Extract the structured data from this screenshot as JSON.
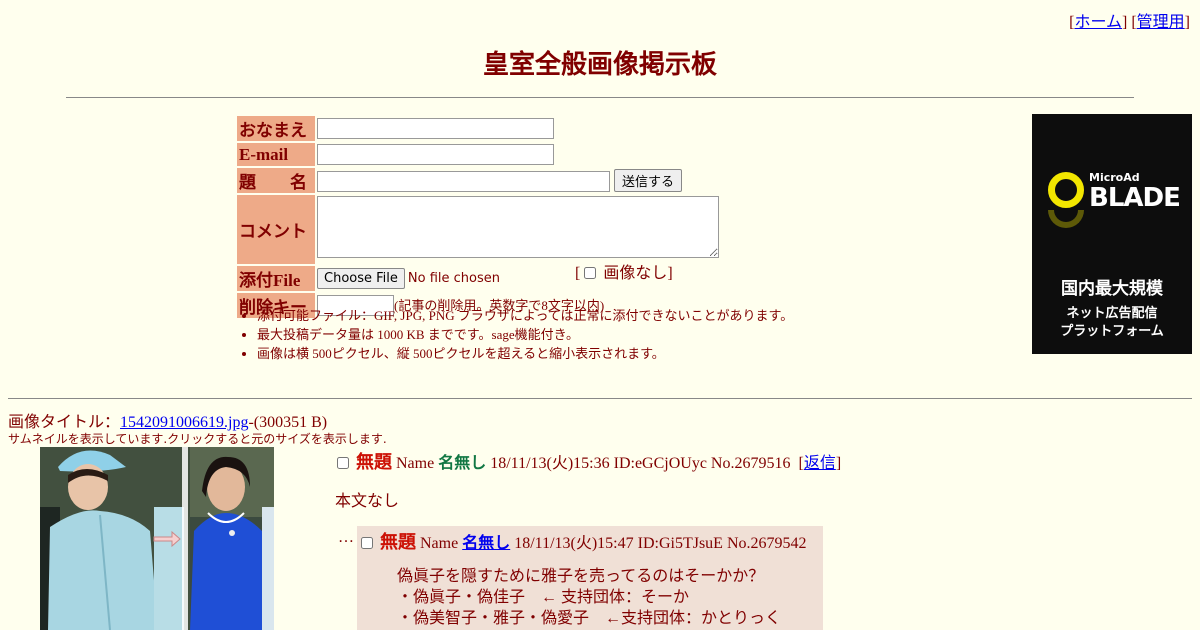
{
  "nav": {
    "home": "ホーム",
    "admin": "管理用",
    "lb": "[",
    "rb": "]"
  },
  "title": "皇室全般画像掲示板",
  "form": {
    "name_label": "おなまえ",
    "email_label": "E-mail",
    "subject_label": "題　　名",
    "submit_label": "送信する",
    "comment_label": "コメント",
    "file_label": "添付File",
    "file_button": "Choose File",
    "file_status": "No file chosen",
    "noimg_lb": "[",
    "noimg_label": "画像なし",
    "noimg_rb": "]",
    "delkey_label": "削除キー",
    "delkey_note": "(記事の削除用。英数字で8文字以内)"
  },
  "notes": [
    "添付可能ファイル：GIF, JPG, PNG ブラウザによっては正常に添付できないことがあります。",
    "最大投稿データ量は 1000 KB までです。sage機能付き。",
    "画像は横 500ピクセル、縦 500ピクセルを超えると縮小表示されます。"
  ],
  "ad": {
    "brand_small": "MicroAd",
    "brand_big": "BLADE",
    "line1": "国内最大規模",
    "line2": "ネット広告配信",
    "line3": "プラットフォーム"
  },
  "thread": {
    "image_title_label": "画像タイトル：",
    "image_file": "1542091006619.jpg",
    "image_size": "-(300351 B)",
    "thumb_note": "サムネイルを表示しています.クリックすると元のサイズを表示します.",
    "op": {
      "subject": "無題",
      "name_label": "Name",
      "name": "名無し",
      "date": "18/11/13(火)15:36 ID:eGCjOUyc No.2679516",
      "reply_lb": "[",
      "reply_link": "返信",
      "reply_rb": "]",
      "body": "本文なし"
    },
    "reply": {
      "marker": "…",
      "subject": "無題",
      "name_label": "Name",
      "name": "名無し",
      "date": "18/11/13(火)15:47 ID:Gi5TJsuE No.2679542",
      "lines": [
        "偽眞子を隠すために雅子を売ってるのはそーかか？",
        "・偽眞子・偽佳子　← 支持団体：そーか",
        "・偽美智子・雅子・偽愛子　←支持団体：かとりっく"
      ]
    }
  }
}
